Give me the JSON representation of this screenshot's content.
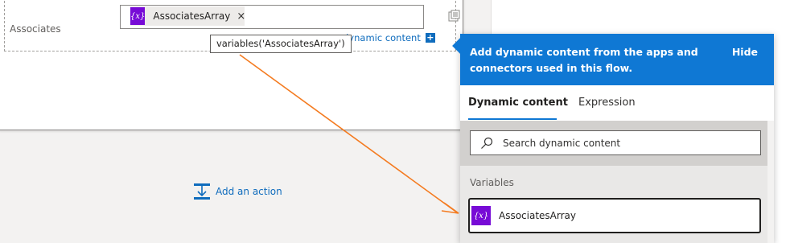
{
  "action_card": {
    "field_label": "Associates",
    "token": {
      "icon": "{x}",
      "label": "AssociatesArray",
      "remove": "×"
    },
    "tooltip": "variables('AssociatesArray')",
    "add_dynamic_label": "dynamic content",
    "add_dynamic_plus": "+"
  },
  "add_action": {
    "label": "Add an action"
  },
  "dynamic_panel": {
    "header_text": "Add dynamic content from the apps and connectors used in this flow.",
    "hide_label": "Hide",
    "tabs": [
      {
        "label": "Dynamic content",
        "active": true
      },
      {
        "label": "Expression",
        "active": false
      }
    ],
    "search": {
      "placeholder": "Search dynamic content",
      "value": ""
    },
    "section": "Variables",
    "items": [
      {
        "icon": "{x}",
        "label": "AssociatesArray"
      }
    ]
  },
  "colors": {
    "accent": "#0f78d4",
    "variable_icon": "#770bd6",
    "link": "#0f6cbd",
    "annotation_arrow": "#f47b20"
  },
  "icons": [
    "variable-icon",
    "remove-token-icon",
    "field-options-icon",
    "add-action-icon",
    "search-icon"
  ]
}
